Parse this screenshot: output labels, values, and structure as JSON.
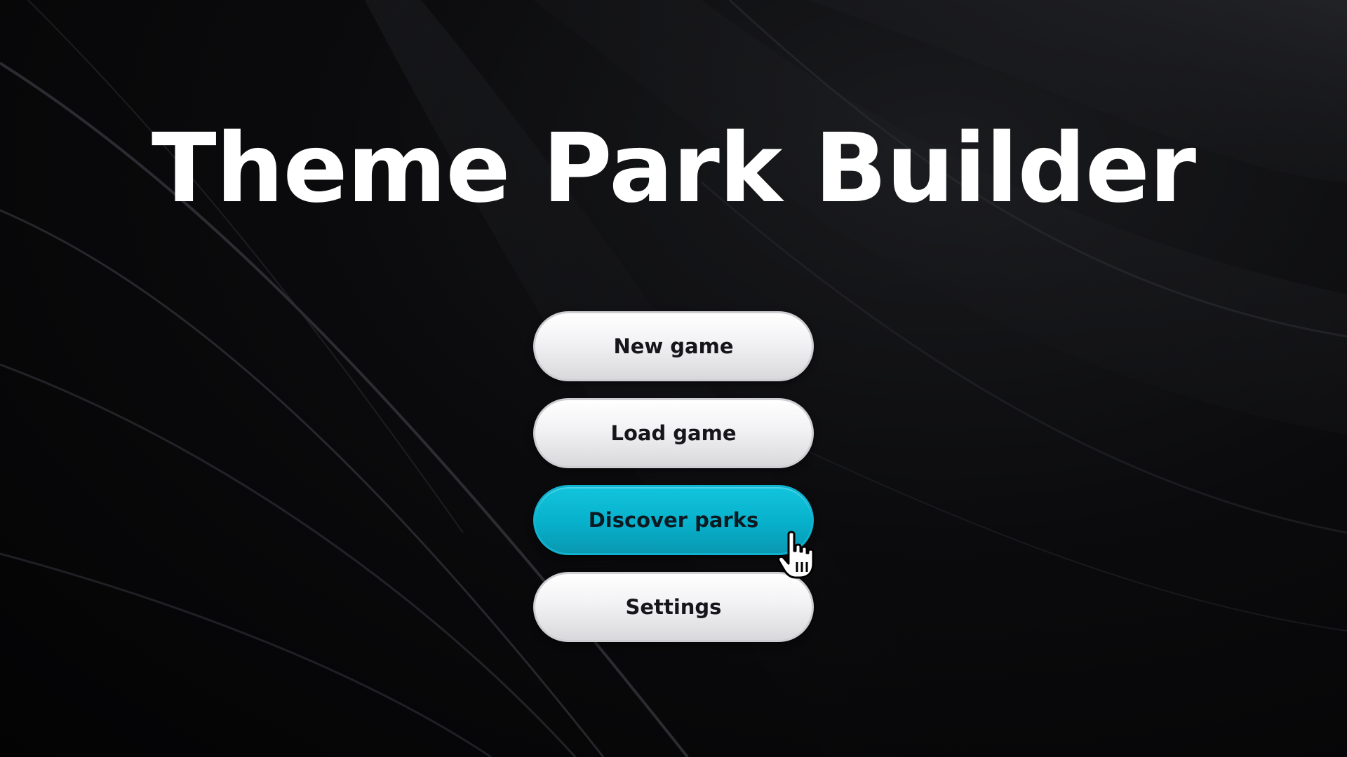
{
  "title": "Theme Park Builder",
  "menu": {
    "items": [
      {
        "label": "New game",
        "state": "normal"
      },
      {
        "label": "Load game",
        "state": "normal"
      },
      {
        "label": "Discover parks",
        "state": "hovered"
      },
      {
        "label": "Settings",
        "state": "normal"
      }
    ]
  },
  "cursor": {
    "icon": "hand-pointer-icon"
  },
  "colors": {
    "background": "#050506",
    "title": "#ffffff",
    "button_face": "#f2f2f4",
    "button_text": "#16161a",
    "accent": "#07b0cb"
  }
}
